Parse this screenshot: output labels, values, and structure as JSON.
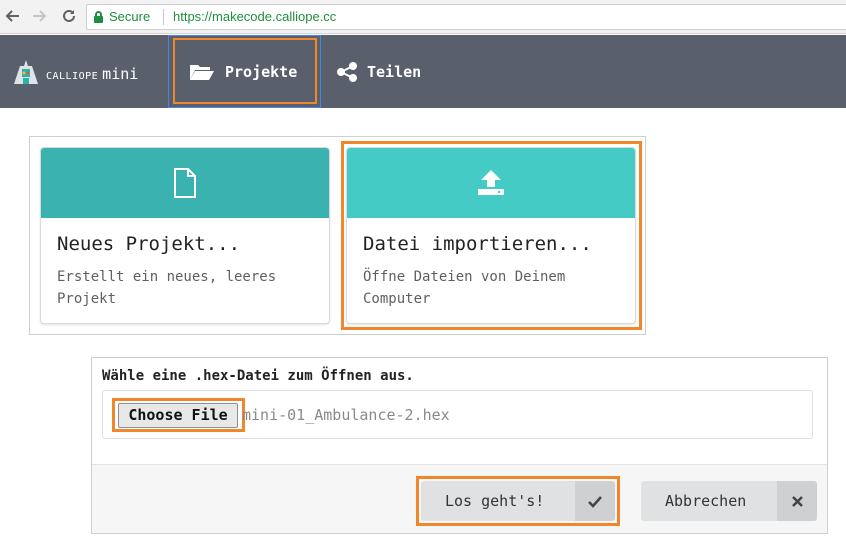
{
  "browser": {
    "secure_label": "Secure",
    "url": "https://makecode.calliope.cc",
    "icons": {
      "back": "back-arrow-icon",
      "forward": "forward-arrow-icon",
      "reload": "reload-icon",
      "lock": "lock-icon"
    }
  },
  "header": {
    "logo_small": "CALLIOPE",
    "logo_big": "mini",
    "menu": [
      {
        "label": "Projekte",
        "icon": "folder-open-icon",
        "highlighted": true
      },
      {
        "label": "Teilen",
        "icon": "share-icon",
        "highlighted": false
      }
    ],
    "background": "#5a606b"
  },
  "cards": [
    {
      "title": "Neues Projekt...",
      "description": "Erstellt ein neues, leeres Projekt",
      "icon": "file-icon",
      "color": "#3ab3b0"
    },
    {
      "title": "Datei importieren...",
      "description": "Öffne Dateien von Deinem Computer",
      "icon": "upload-icon",
      "color": "#44cbc6",
      "highlighted": true
    }
  ],
  "dialog": {
    "prompt": "Wähle eine .hex-Datei zum Öffnen aus.",
    "choose_file_label": "Choose File",
    "file_name": "mini-01_Ambulance-2.hex",
    "confirm_label": "Los geht's!",
    "confirm_icon": "checkmark-icon",
    "cancel_label": "Abbrechen",
    "cancel_icon": "close-icon"
  },
  "highlight_color": "#f0872d"
}
